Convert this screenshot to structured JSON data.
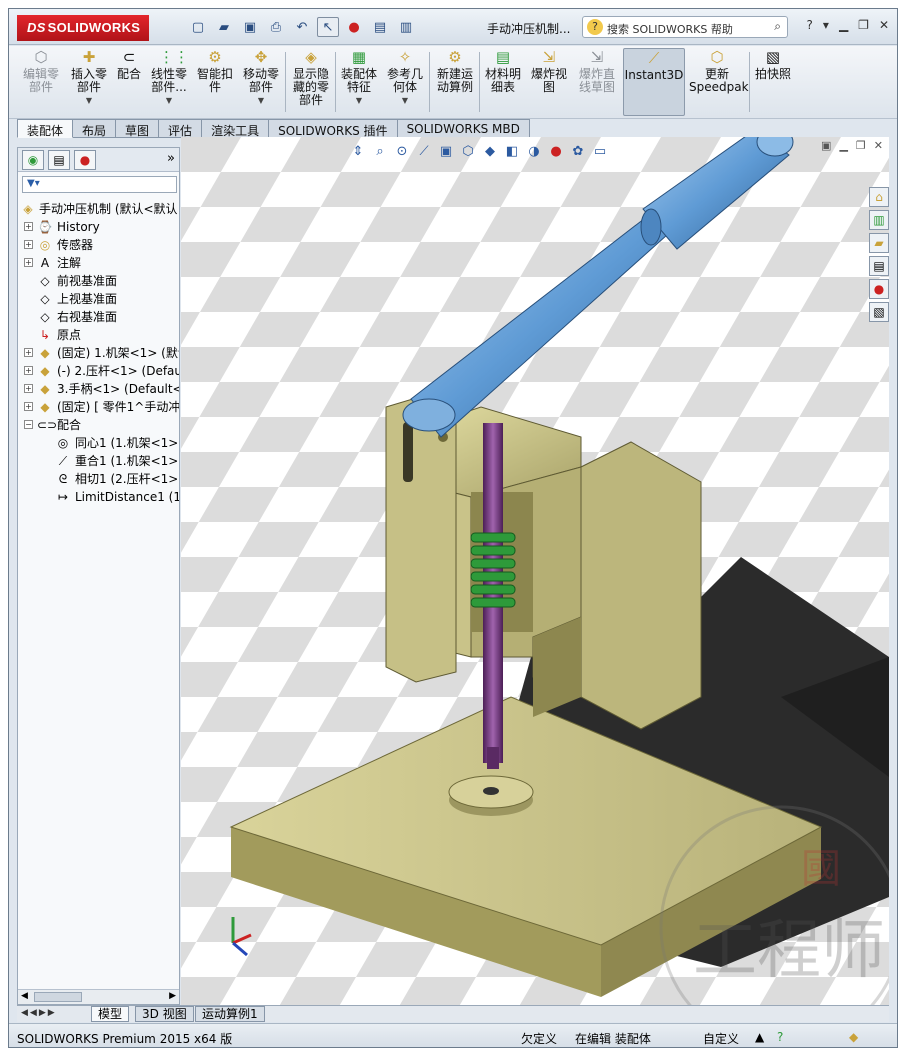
{
  "app": {
    "logo": "SOLIDWORKS",
    "document_title": "手动冲压机制...",
    "search_placeholder": "搜索 SOLIDWORKS 帮助"
  },
  "command_manager": {
    "items": [
      {
        "label": "编辑零\n部件",
        "state": "disabled"
      },
      {
        "label": "插入零\n部件",
        "state": "normal"
      },
      {
        "label": "配合",
        "state": "normal"
      },
      {
        "label": "线性零\n部件...",
        "state": "normal"
      },
      {
        "label": "智能扣\n件",
        "state": "normal"
      },
      {
        "label": "移动零\n部件",
        "state": "normal"
      },
      {
        "label": "显示隐\n藏的零\n部件",
        "state": "normal"
      },
      {
        "label": "装配体\n特征",
        "state": "normal"
      },
      {
        "label": "参考几\n何体",
        "state": "normal"
      },
      {
        "label": "新建运\n动算例",
        "state": "normal"
      },
      {
        "label": "材料明\n细表",
        "state": "normal"
      },
      {
        "label": "爆炸视\n图",
        "state": "normal"
      },
      {
        "label": "爆炸直\n线草图",
        "state": "disabled"
      },
      {
        "label": "Instant3D",
        "state": "active"
      },
      {
        "label": "更新\nSpeedpak",
        "state": "normal"
      },
      {
        "label": "拍快照",
        "state": "normal"
      }
    ]
  },
  "tabs": [
    "装配体",
    "布局",
    "草图",
    "评估",
    "渲染工具",
    "SOLIDWORKS 插件",
    "SOLIDWORKS MBD"
  ],
  "feature_tree": {
    "root": "手动冲压机制 (默认<默认",
    "nodes": [
      {
        "label": "History",
        "icon": "history-icon",
        "expand": "+"
      },
      {
        "label": "传感器",
        "icon": "sensor-icon",
        "expand": "+"
      },
      {
        "label": "注解",
        "icon": "annotation-icon",
        "expand": "+"
      },
      {
        "label": "前视基准面",
        "icon": "plane-icon",
        "expand": ""
      },
      {
        "label": "上视基准面",
        "icon": "plane-icon",
        "expand": ""
      },
      {
        "label": "右视基准面",
        "icon": "plane-icon",
        "expand": ""
      },
      {
        "label": "原点",
        "icon": "origin-icon",
        "expand": ""
      },
      {
        "label": "(固定) 1.机架<1> (默认",
        "icon": "part-icon",
        "expand": "+"
      },
      {
        "label": "(-) 2.压杆<1> (Defau",
        "icon": "part-icon",
        "expand": "+"
      },
      {
        "label": "3.手柄<1> (Default<",
        "icon": "part-icon",
        "expand": "+"
      },
      {
        "label": "(固定) [ 零件1^手动冲",
        "icon": "part-icon",
        "expand": "+"
      },
      {
        "label": "配合",
        "icon": "mates-icon",
        "expand": "−"
      }
    ],
    "mates": [
      {
        "label": "同心1 (1.机架<1>,",
        "icon": "concentric-icon"
      },
      {
        "label": "重合1 (1.机架<1>,",
        "icon": "coincident-icon"
      },
      {
        "label": "相切1 (2.压杆<1>,",
        "icon": "tangent-icon"
      },
      {
        "label": "LimitDistance1 (1.",
        "icon": "limit-distance-icon"
      }
    ]
  },
  "bottom_tabs": [
    "模型",
    "3D 视图",
    "运动算例1"
  ],
  "status_bar": {
    "product": "SOLIDWORKS Premium 2015 x64 版",
    "definition": "欠定义",
    "mode": "在编辑 装配体",
    "units": "自定义"
  },
  "watermark": {
    "text": "工程师",
    "seal": "國"
  },
  "colors": {
    "model_body": "#cfc88e",
    "model_shadow": "#2b2b2b",
    "handle_blue": "#5f9bd5",
    "spring_green": "#2e9a3a",
    "ram_purple": "#7a3d86",
    "floor_checker": "#d9d9d9"
  }
}
